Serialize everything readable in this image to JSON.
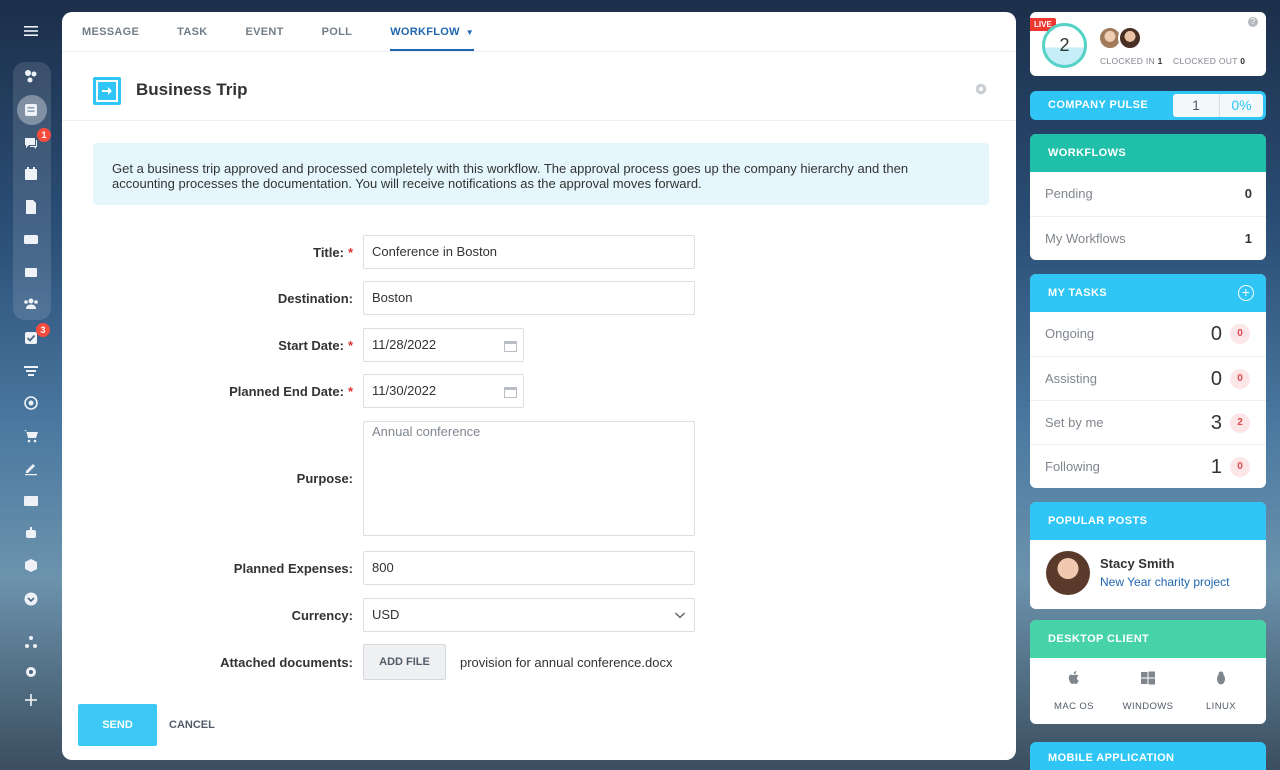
{
  "sidebar": {
    "badges": {
      "chat": "1",
      "tasks": "3"
    }
  },
  "tabs": [
    {
      "label": "MESSAGE"
    },
    {
      "label": "TASK"
    },
    {
      "label": "EVENT"
    },
    {
      "label": "POLL"
    },
    {
      "label": "WORKFLOW"
    }
  ],
  "workflow": {
    "title": "Business Trip",
    "description": "Get a business trip approved and processed completely with this workflow. The approval process goes up the company hierarchy and then accounting processes the documentation. You will receive notifications as the approval moves forward."
  },
  "form": {
    "title": {
      "label": "Title:",
      "value": "Conference in Boston"
    },
    "destination": {
      "label": "Destination:",
      "value": "Boston"
    },
    "start_date": {
      "label": "Start Date:",
      "value": "11/28/2022"
    },
    "end_date": {
      "label": "Planned End Date:",
      "value": "11/30/2022"
    },
    "purpose": {
      "label": "Purpose:",
      "placeholder": "Annual conference"
    },
    "expenses": {
      "label": "Planned Expenses:",
      "value": "800"
    },
    "currency": {
      "label": "Currency:",
      "value": "USD"
    },
    "attachments": {
      "label": "Attached documents:",
      "button": "ADD FILE",
      "filename": "provision for annual conference.docx"
    },
    "required_mark": "*"
  },
  "actions": {
    "send": "SEND",
    "cancel": "CANCEL"
  },
  "right": {
    "clock": {
      "live": "LIVE",
      "count": "2",
      "clocked_in_label": "CLOCKED IN",
      "clocked_in": "1",
      "clocked_out_label": "CLOCKED OUT",
      "clocked_out": "0",
      "help": "?"
    },
    "pulse": {
      "label": "COMPANY PULSE",
      "value": "1",
      "percent": "0%"
    },
    "workflows": {
      "title": "WORKFLOWS",
      "rows": [
        {
          "label": "Pending",
          "value": "0"
        },
        {
          "label": "My Workflows",
          "value": "1"
        }
      ]
    },
    "tasks": {
      "title": "MY TASKS",
      "add": "+",
      "rows": [
        {
          "label": "Ongoing",
          "value": "0",
          "count": "0"
        },
        {
          "label": "Assisting",
          "value": "0",
          "count": "0"
        },
        {
          "label": "Set by me",
          "value": "3",
          "count": "2"
        },
        {
          "label": "Following",
          "value": "1",
          "count": "0"
        }
      ]
    },
    "popular": {
      "title": "POPULAR POSTS",
      "name": "Stacy Smith",
      "post": "New Year charity project"
    },
    "desktop": {
      "title": "DESKTOP CLIENT",
      "items": [
        "MAC OS",
        "WINDOWS",
        "LINUX"
      ]
    },
    "mobile": {
      "title": "MOBILE APPLICATION"
    }
  },
  "colors": {
    "accent": "#2fc6f6",
    "teal": "#1fbfa9",
    "link": "#2067b0",
    "send": "#3bc8f5"
  }
}
